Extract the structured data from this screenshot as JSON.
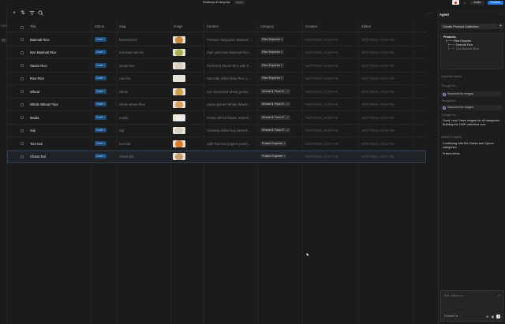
{
  "app": {
    "title": "Khaleeja Enterprise",
    "badge": "Draft",
    "invite_label": "Invite",
    "publish_label": "Publish"
  },
  "sidebar_strip": [
    "CMS",
    "17"
  ],
  "columns": {
    "title": "Title",
    "status": "Status",
    "slug": "Slug",
    "image": "Image",
    "content": "Content",
    "category": "Category",
    "created": "Created",
    "edited": "Edited"
  },
  "rows": [
    {
      "title": "Basmati Rice",
      "status": "Draft",
      "slug": "basmati-rice",
      "content": "Premium long-grain Basmati Ri...",
      "category": "Rice Exporter",
      "created": "06/07/2026, 02:58 PM",
      "edited": "06/07/2026, 02:58 PM"
    },
    {
      "title": "Non Basmati Rice",
      "status": "Draft",
      "slug": "non-basmati-rice",
      "content": "High-yield Non-Basmati Rice...",
      "category": "Rice Exporter",
      "created": "06/07/2026, 02:58 PM",
      "edited": "06/07/2026, 02:58 PM"
    },
    {
      "title": "Steam Rice",
      "status": "Draft",
      "slug": "steam-rice",
      "content": "Perfected Steam Rice with R...",
      "category": "Rice Exporter",
      "created": "06/07/2026, 02:58 PM",
      "edited": "06/07/2026, 02:58 PM"
    },
    {
      "title": "Raw Rice",
      "status": "Draft",
      "slug": "raw-rice",
      "content": "Naturally milled Raw Rice, r...",
      "category": "Rice Exporter",
      "created": "06/07/2026, 02:58 PM",
      "edited": "06/07/2026, 02:58 PM"
    },
    {
      "title": "Wheat",
      "status": "Draft",
      "slug": "wheat",
      "content": "Sun-harvested wheat grains, ...",
      "category": "Wheat & Flour E...",
      "created": "06/07/2026, 02:58 PM",
      "edited": "06/07/2026, 02:58 PM"
    },
    {
      "title": "Whole Wheat Flour",
      "status": "Draft",
      "slug": "whole-wheat-flour",
      "content": "Stone-ground Whole Wheat ...",
      "category": "Wheat & Flour E...",
      "created": "06/07/2026, 02:58 PM",
      "edited": "06/07/2026, 02:58 PM"
    },
    {
      "title": "Maida",
      "status": "Draft",
      "slug": "maida",
      "content": "Finely refined Maida, essenti...",
      "category": "Wheat & Flour E...",
      "created": "06/07/2026, 02:58 PM",
      "edited": "06/07/2026, 02:58 PM"
    },
    {
      "title": "Suji",
      "status": "Draft",
      "slug": "suji",
      "content": "Coarsely milled Suji (semoli...",
      "category": "Wheat & Flour E...",
      "created": "06/07/2026, 02:58 PM",
      "edited": "06/07/2026, 02:58 PM"
    },
    {
      "title": "Toor Dal",
      "status": "Draft",
      "slug": "toor-dal",
      "content": "Split Toor Dal (pigeon peas)...",
      "category": "Pulses Exporter",
      "created": "06/07/2026, 02:57 PM",
      "edited": "06/07/2026, 02:58 PM"
    },
    {
      "title": "Chana Dal",
      "status": "Draft",
      "slug": "chana-dal",
      "content": "",
      "category": "Pulses Exporter",
      "created": "06/07/2026, 02:57 PM",
      "edited": "06/07/2026, 02:57 PM"
    }
  ],
  "thumb_colors": [
    "#c98a3a",
    "#a7b04a",
    "#d8d0c0",
    "#e6e2d8",
    "#c9a24a",
    "#d6a060",
    "#f0ece6",
    "#d8cfc0",
    "#e07a2a",
    "#c8a070"
  ],
  "agent": {
    "title": "Agent",
    "task_chip": "Create Product Collection",
    "tree": {
      "root": "Products",
      "level1": "Rice Exporter",
      "level2": "Basmati Rice",
      "level3": "Non Basmati Rice"
    },
    "step1": "Inspected layers",
    "thought1": "Thought for...",
    "search1": "Searched for images",
    "thought2": "Thought for...",
    "search2": "Searched for images",
    "thought3": "Thought for...",
    "msg1": "Good, now I have images for all categories. Building the CMS collection now.",
    "step2": "Added 29 layers",
    "msg2": "Continuing with the Pulses and Spices categories.",
    "msg3": "Pulses items",
    "composer_placeholder": "Ask, follow up...",
    "model_label": "Gemini 3"
  },
  "colors": {
    "accent": "#1e74e8",
    "status_badge_bg": "#1c4a7a"
  }
}
